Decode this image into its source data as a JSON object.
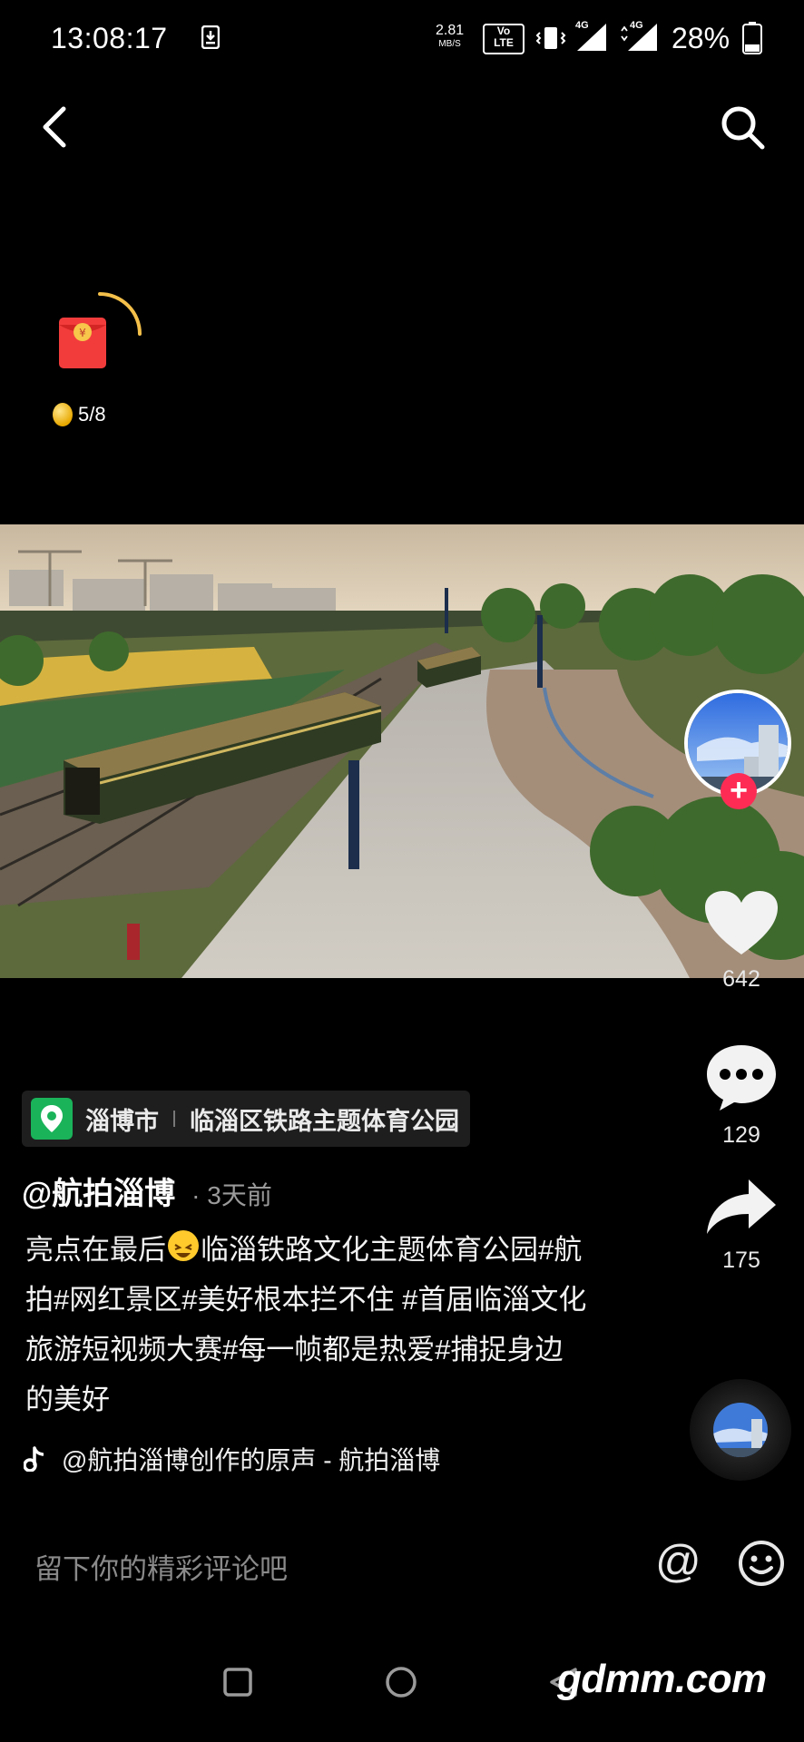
{
  "status_bar": {
    "time": "13:08:17",
    "net_speed_value": "2.81",
    "net_speed_unit": "MB/S",
    "volte_top": "Vo",
    "volte_bottom": "LTE",
    "signal1_label": "4G",
    "signal2_label": "4G",
    "battery": "28%"
  },
  "header": {
    "back_icon": "chevron-left-icon",
    "search_icon": "search-icon"
  },
  "reward": {
    "progress": "5/8",
    "progress_fraction": 0.25
  },
  "actions": {
    "likes": "642",
    "comments": "129",
    "shares": "175"
  },
  "location": {
    "city": "淄博市",
    "place": "临淄区铁路主题体育公园"
  },
  "post": {
    "author": "@航拍淄博",
    "time": "· 3天前",
    "caption_part1": "亮点在最后",
    "caption_part2": "临淄铁路文化主题体育公园#航拍#网红景区#美好根本拦不住 #首届临淄文化旅游短视频大赛#每一帧都是热爱#捕捉身边的美好"
  },
  "music": {
    "title": "@航拍淄博创作的原声 - 航拍淄博"
  },
  "comment": {
    "placeholder": "留下你的精彩评论吧",
    "at_symbol": "@"
  },
  "watermark": "gdmm.com",
  "colors": {
    "accent_pink": "#fe2c55",
    "location_green": "#1ab35a",
    "background": "#000000"
  }
}
